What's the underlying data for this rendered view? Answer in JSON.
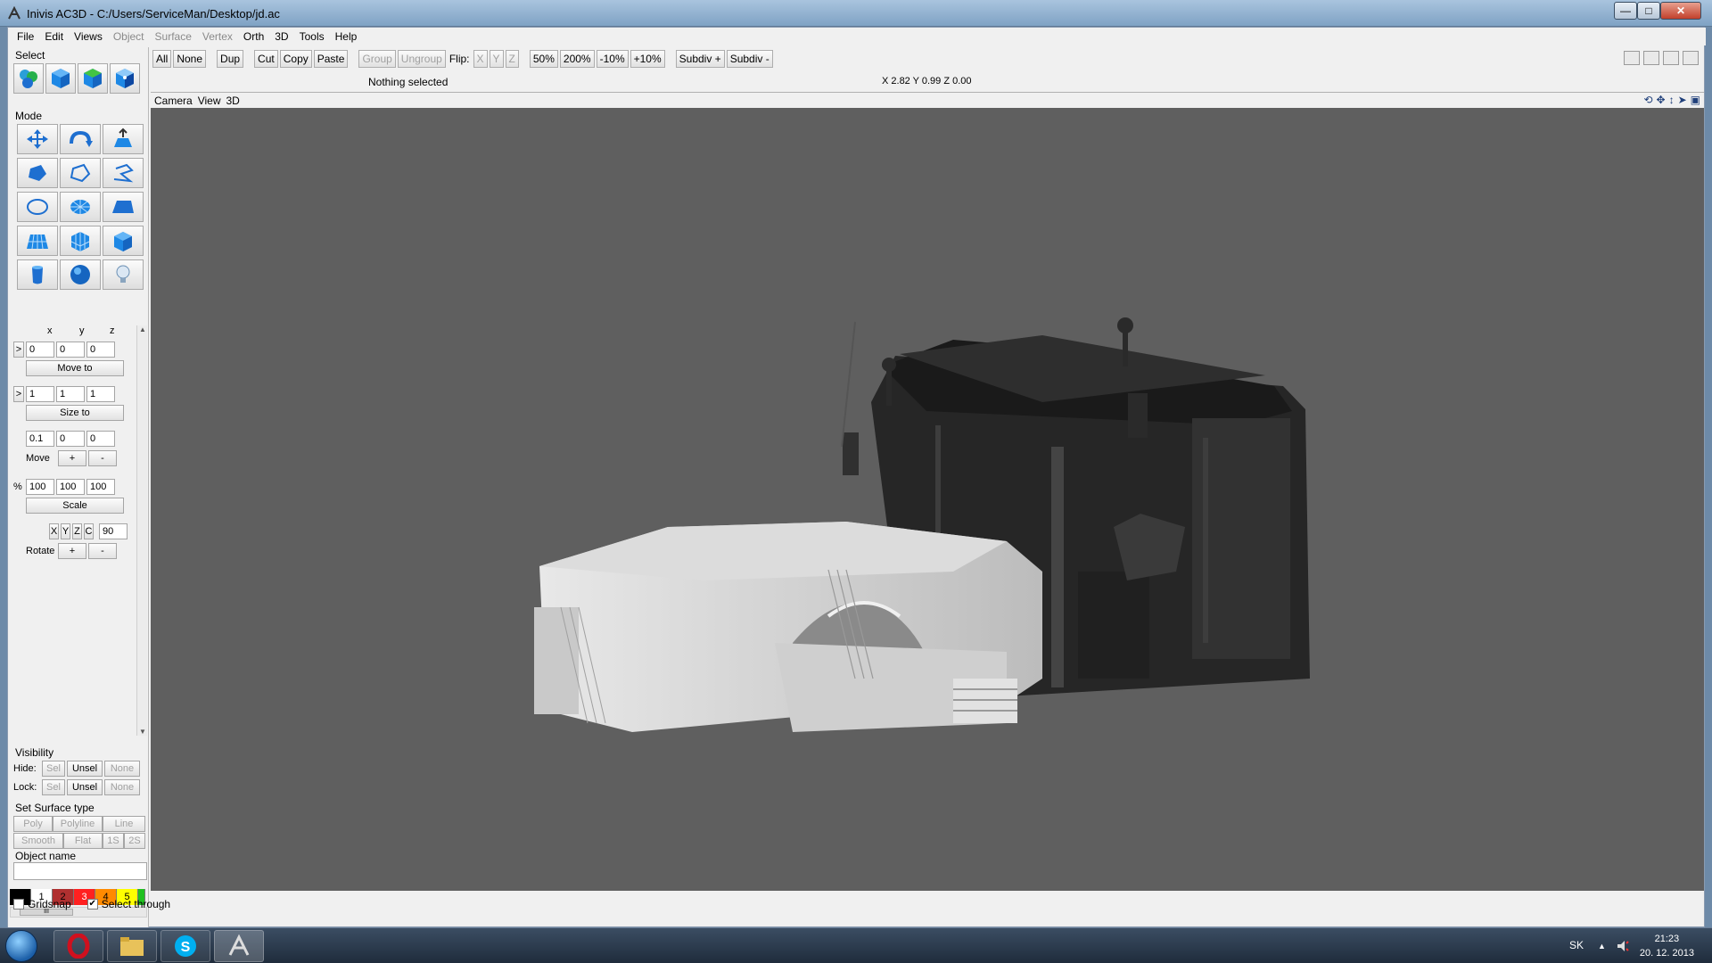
{
  "window": {
    "title": "Inivis AC3D - C:/Users/ServiceMan/Desktop/jd.ac",
    "min": "—",
    "max": "□",
    "close": "✕"
  },
  "menu": [
    "File",
    "Edit",
    "Views",
    "Object",
    "Surface",
    "Vertex",
    "Orth",
    "3D",
    "Tools",
    "Help"
  ],
  "menu_disabled": [
    "Object",
    "Surface",
    "Vertex"
  ],
  "toolbar": {
    "all": "All",
    "none": "None",
    "dup": "Dup",
    "cut": "Cut",
    "copy": "Copy",
    "paste": "Paste",
    "group": "Group",
    "ungroup": "Ungroup",
    "flip": "Flip:",
    "fx": "X",
    "fy": "Y",
    "fz": "Z",
    "z50": "50%",
    "z200": "200%",
    "m10": "-10%",
    "p10": "+10%",
    "subdiv_plus": "Subdiv +",
    "subdiv_minus": "Subdiv -"
  },
  "status": {
    "selection": "Nothing selected",
    "coords": "X 2.82 Y 0.99 Z 0.00"
  },
  "left": {
    "select_label": "Select",
    "mode_label": "Mode",
    "axis": {
      "x": "x",
      "y": "y",
      "z": "z"
    },
    "pos_arrow": ">",
    "position": [
      "0",
      "0",
      "0"
    ],
    "move_to": "Move to",
    "size_arrow": ">",
    "size": [
      "1",
      "1",
      "1"
    ],
    "size_to": "Size to",
    "move_delta": [
      "0.1",
      "0",
      "0"
    ],
    "move": "Move",
    "plus": "+",
    "minus": "-",
    "pct": "%",
    "scale_vals": [
      "100",
      "100",
      "100"
    ],
    "scale": "Scale",
    "rot_axes": [
      "X",
      "Y",
      "Z",
      "C"
    ],
    "rot_angle": "90",
    "rotate": "Rotate",
    "visibility": "Visibility",
    "hide": "Hide:",
    "lock": "Lock:",
    "sel": "Sel",
    "unsel": "Unsel",
    "none": "None",
    "surface_type": "Set Surface type",
    "poly": "Poly",
    "polyline": "Polyline",
    "line": "Line",
    "smooth": "Smooth",
    "flat": "Flat",
    "s1": "1S",
    "s2": "2S",
    "object_name": "Object name",
    "object_name_value": "",
    "palette": [
      {
        "label": "",
        "color": "#000000",
        "fg": "#ffffff"
      },
      {
        "label": "1",
        "color": "#ffffff",
        "fg": "#000000"
      },
      {
        "label": "2",
        "color": "#b03030",
        "fg": "#000000"
      },
      {
        "label": "3",
        "color": "#ff2020",
        "fg": "#ffffff"
      },
      {
        "label": "4",
        "color": "#ff8a00",
        "fg": "#000000"
      },
      {
        "label": "5",
        "color": "#ffff00",
        "fg": "#000000"
      },
      {
        "label": "",
        "color": "#20c020",
        "fg": "#000000"
      }
    ],
    "hscroll_thumb": "III"
  },
  "viewport_header": {
    "camera": "Camera",
    "view": "View",
    "d3": "3D"
  },
  "bottom": {
    "gridsnap": "Gridsnap",
    "gridsnap_checked": false,
    "select_through": "Select through",
    "select_through_checked": true
  },
  "taskbar": {
    "lang": "SK",
    "tray_arrow": "▲",
    "time": "21:23",
    "date": "20. 12. 2013"
  }
}
